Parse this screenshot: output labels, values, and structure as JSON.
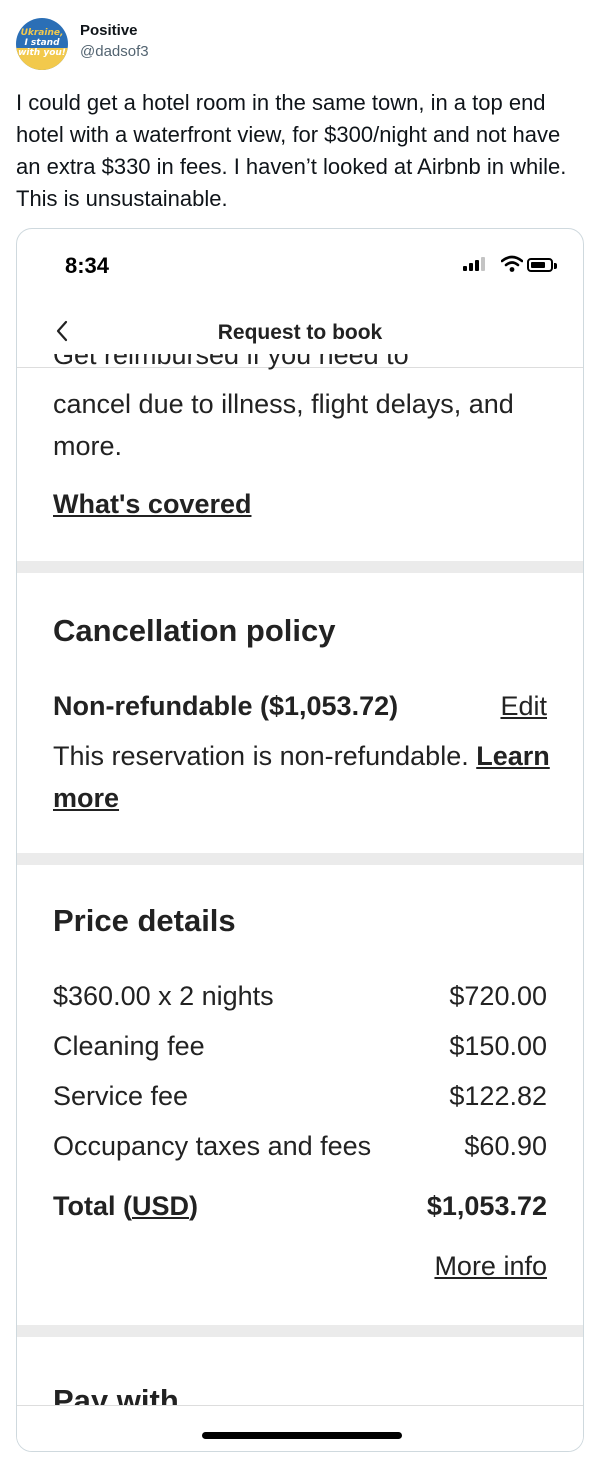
{
  "tweet": {
    "avatar_text": [
      "Ukraine,",
      "I stand",
      "with you!"
    ],
    "display_name": "Positive",
    "handle": "@dadsof3",
    "text": "I could get a hotel room in the same town, in a top end hotel with a waterfront view, for $300/night and not have an extra $330 in fees. I haven’t looked at Airbnb in while. This is unsustainable."
  },
  "phone": {
    "status_time": "8:34",
    "nav_title": "Request to book",
    "back_icon": "chevron-left-icon",
    "trip_insurance": {
      "cut_text": "Get reimbursed if you need to",
      "body": "cancel due to illness, flight delays, and more.",
      "link": "What's covered"
    },
    "cancellation": {
      "heading": "Cancellation policy",
      "policy": "Non-refundable ($1,053.72)",
      "edit": "Edit",
      "body": "This reservation is non-refundable.",
      "learn_more": "Learn more"
    },
    "price_details": {
      "heading": "Price details",
      "rows": [
        {
          "label": "$360.00 x 2 nights",
          "amount": "$720.00"
        },
        {
          "label": "Cleaning fee",
          "amount": "$150.00"
        },
        {
          "label": "Service fee",
          "amount": "$122.82"
        },
        {
          "label": "Occupancy taxes and fees",
          "amount": "$60.90"
        }
      ],
      "total_label": "Total (",
      "total_currency": "USD",
      "total_label_end": ")",
      "total_amount": "$1,053.72",
      "more_info": "More info"
    },
    "pay_with": "Pay with"
  },
  "colors": {
    "text": "#222222",
    "divider_band": "#ebebeb",
    "twitter_secondary": "#536471"
  }
}
